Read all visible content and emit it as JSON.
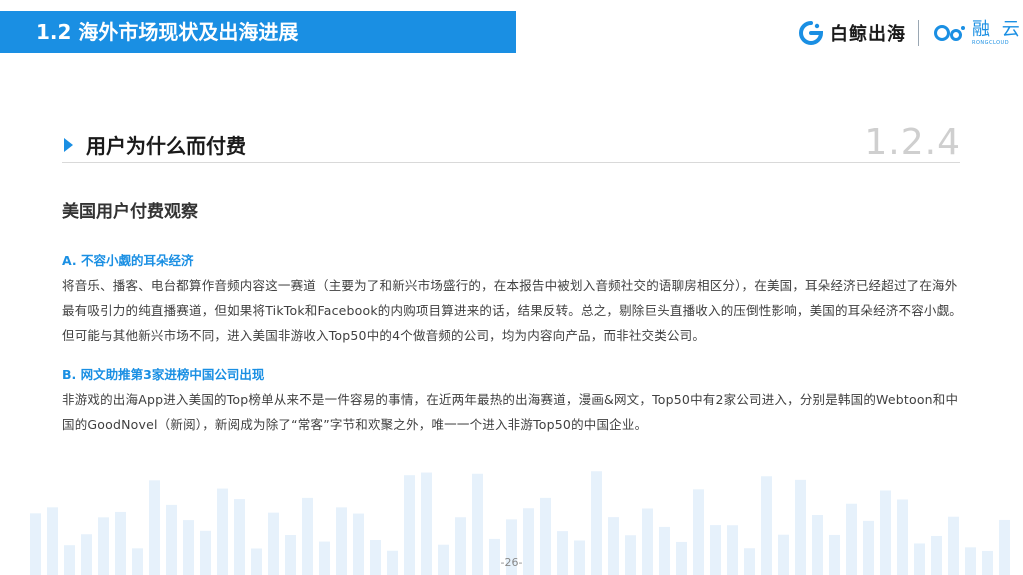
{
  "header": {
    "title": "1.2 海外市场现状及出海进展",
    "brand_primary": "白鲸出海",
    "brand_secondary": "融 云",
    "brand_secondary_sub": "RONGCLOUD",
    "accent_color": "#1a8fe3"
  },
  "section": {
    "title": "用户为什么而付费",
    "number": "1.2.4"
  },
  "subtitle": "美国用户付费观察",
  "blocks": [
    {
      "heading": "A. 不容小觑的耳朵经济",
      "body": "将音乐、播客、电台都算作音频内容这一赛道（主要为了和新兴市场盛行的，在本报告中被划入音频社交的语聊房相区分），在美国，耳朵经济已经超过了在海外最有吸引力的纯直播赛道，但如果将TikTok和Facebook的内购项目算进来的话，结果反转。总之，剔除巨头直播收入的压倒性影响，美国的耳朵经济不容小觑。但可能与其他新兴市场不同，进入美国非游收入Top50中的4个做音频的公司，均为内容向产品，而非社交类公司。"
    },
    {
      "heading": "B. 网文助推第3家进榜中国公司出现",
      "body": "非游戏的出海App进入美国的Top榜单从来不是一件容易的事情，在近两年最热的出海赛道，漫画&网文，Top50中有2家公司进入，分别是韩国的Webtoon和中国的GoodNovel（新阅），新阅成为除了“常客”字节和欢聚之外，唯一一个进入非游Top50的中国企业。"
    }
  ],
  "footer": {
    "page_number": "-26-"
  }
}
